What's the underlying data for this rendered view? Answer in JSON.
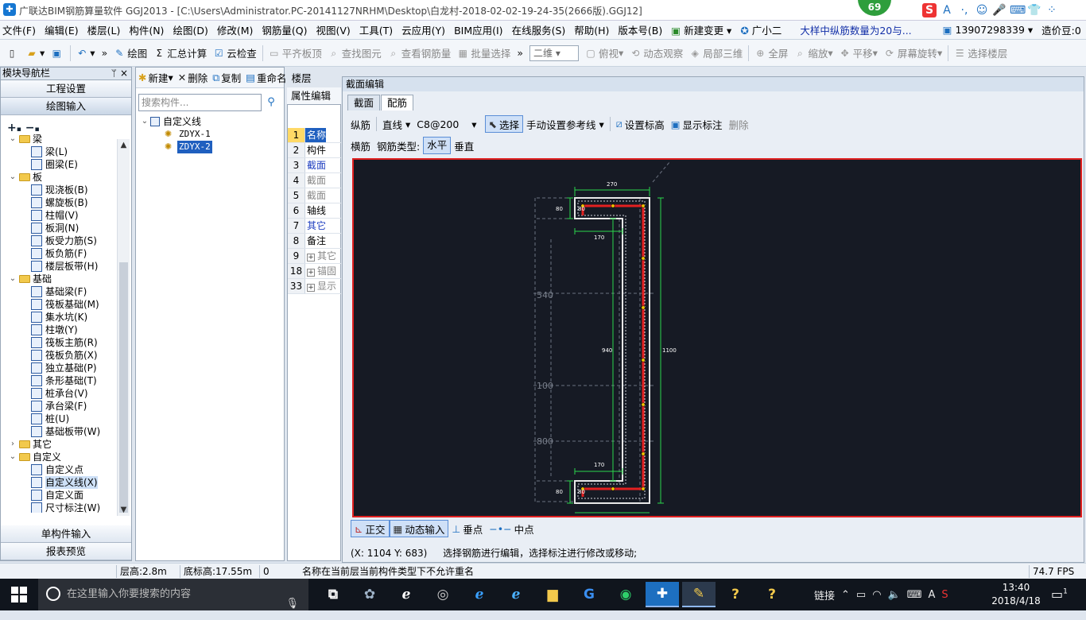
{
  "titlebar": {
    "title": "广联达BIM钢筋算量软件 GGJ2013 - [C:\\Users\\Administrator.PC-20141127NRHM\\Desktop\\白龙村-2018-02-02-19-24-35(2666版).GGJ12]",
    "badge": "69",
    "ime_icons": [
      "S",
      "A",
      "·,",
      "☺",
      "🎤",
      "⌨",
      "👕",
      "⁘"
    ]
  },
  "menubar": {
    "items": [
      "文件(F)",
      "编辑(E)",
      "楼层(L)",
      "构件(N)",
      "绘图(D)",
      "修改(M)",
      "钢筋量(Q)",
      "视图(V)",
      "工具(T)",
      "云应用(Y)",
      "BIM应用(I)",
      "在线服务(S)",
      "帮助(H)",
      "版本号(B)"
    ],
    "new_change": "新建变更",
    "assistant": "广小二",
    "notice": "大样中纵筋数量为20与...",
    "phone": "13907298339",
    "beans": "造价豆:0"
  },
  "toolbar": {
    "draw": "绘图",
    "sum": "汇总计算",
    "cloud_check": "云检查",
    "flat_top": "平齐板顶",
    "find_elem": "查找图元",
    "view_rebar": "查看钢筋量",
    "batch_select": "批量选择",
    "view_mode": "二维",
    "top_view": "俯视",
    "dyn_observe": "动态观察",
    "local_3d": "局部三维",
    "fullscreen": "全屏",
    "zoom": "缩放",
    "pan": "平移",
    "rotate": "屏幕旋转",
    "select_floor": "选择楼层"
  },
  "nav": {
    "title": "模块导航栏",
    "pin": "ᛘ",
    "close": "×",
    "top_buttons": [
      "工程设置",
      "绘图输入"
    ],
    "tree": [
      {
        "type": "folder",
        "label": "梁",
        "expanded": true
      },
      {
        "type": "leaf",
        "label": "梁(L)"
      },
      {
        "type": "leaf",
        "label": "圈梁(E)"
      },
      {
        "type": "folder",
        "label": "板",
        "expanded": true
      },
      {
        "type": "leaf",
        "label": "现浇板(B)"
      },
      {
        "type": "leaf",
        "label": "螺旋板(B)"
      },
      {
        "type": "leaf",
        "label": "柱帽(V)"
      },
      {
        "type": "leaf",
        "label": "板洞(N)"
      },
      {
        "type": "leaf",
        "label": "板受力筋(S)"
      },
      {
        "type": "leaf",
        "label": "板负筋(F)"
      },
      {
        "type": "leaf",
        "label": "楼层板带(H)"
      },
      {
        "type": "folder",
        "label": "基础",
        "expanded": true
      },
      {
        "type": "leaf",
        "label": "基础梁(F)"
      },
      {
        "type": "leaf",
        "label": "筏板基础(M)"
      },
      {
        "type": "leaf",
        "label": "集水坑(K)"
      },
      {
        "type": "leaf",
        "label": "柱墩(Y)"
      },
      {
        "type": "leaf",
        "label": "筏板主筋(R)"
      },
      {
        "type": "leaf",
        "label": "筏板负筋(X)"
      },
      {
        "type": "leaf",
        "label": "独立基础(P)"
      },
      {
        "type": "leaf",
        "label": "条形基础(T)"
      },
      {
        "type": "leaf",
        "label": "桩承台(V)"
      },
      {
        "type": "leaf",
        "label": "承台梁(F)"
      },
      {
        "type": "leaf",
        "label": "桩(U)"
      },
      {
        "type": "leaf",
        "label": "基础板带(W)"
      },
      {
        "type": "folder",
        "label": "其它",
        "expanded": false
      },
      {
        "type": "folder",
        "label": "自定义",
        "expanded": true
      },
      {
        "type": "leaf",
        "label": "自定义点"
      },
      {
        "type": "leaf",
        "label": "自定义线(X)",
        "selected": true
      },
      {
        "type": "leaf",
        "label": "自定义面"
      },
      {
        "type": "leaf",
        "label": "尺寸标注(W)"
      }
    ],
    "bottom_buttons": [
      "单构件输入",
      "报表预览"
    ]
  },
  "component": {
    "new": "新建",
    "delete": "删除",
    "copy": "复制",
    "rename": "重命名",
    "floor": "楼层",
    "search_placeholder": "搜索构件...",
    "root": "自定义线",
    "items": [
      "ZDYX-1",
      "ZDYX-2"
    ]
  },
  "properties": {
    "tab": "属性编辑",
    "rows": [
      {
        "n": "1",
        "label": "名称",
        "style": "sel"
      },
      {
        "n": "2",
        "label": "构件",
        "style": ""
      },
      {
        "n": "3",
        "label": "截面",
        "style": "blue"
      },
      {
        "n": "4",
        "label": "截面",
        "style": "gray"
      },
      {
        "n": "5",
        "label": "截面",
        "style": "gray"
      },
      {
        "n": "6",
        "label": "轴线",
        "style": ""
      },
      {
        "n": "7",
        "label": "其它",
        "style": "blue"
      },
      {
        "n": "8",
        "label": "备注",
        "style": ""
      },
      {
        "n": "9",
        "label": "其它",
        "style": "gray",
        "plus": true
      },
      {
        "n": "18",
        "label": "锚固",
        "style": "gray",
        "plus": true
      },
      {
        "n": "33",
        "label": "显示",
        "style": "gray",
        "plus": true
      }
    ]
  },
  "section_editor": {
    "title": "截面编辑",
    "tabs": [
      "截面",
      "配筋"
    ],
    "active_tab": 1,
    "longitudinal": "纵筋",
    "line_mode": "直线",
    "spec": "C8@200",
    "select": "选择",
    "ref_line": "手动设置参考线",
    "set_elevation": "设置标高",
    "show_annot": "显示标注",
    "delete": "删除",
    "transverse": "横筋",
    "rebar_type_label": "钢筋类型:",
    "horizontal": "水平",
    "vertical": "垂直",
    "ortho": "正交",
    "dyn_input": "动态输入",
    "perp_point": "垂点",
    "mid_point": "中点",
    "coords": "(X: 1104 Y: 683)",
    "hint": "选择钢筋进行编辑，选择标注进行修改或移动;"
  },
  "drawing": {
    "dims": {
      "top": "270",
      "top_left_h": "80",
      "top_inner_h": "80",
      "upper_inner": "170",
      "lower_inner": "170",
      "web_inner": "940",
      "overall": "1100",
      "bottom_h": "80",
      "bottom_inner_h": "80"
    },
    "bg_labels": [
      "540",
      "100",
      "800"
    ],
    "colors": {
      "bg": "#161a24",
      "outline": "#e8e8e8",
      "rebar": "#e32020",
      "dim": "#2bd64b",
      "node": "#f2c200"
    }
  },
  "statusbar": {
    "floor_height": "层高:2.8m",
    "base_elev": "底标高:17.55m",
    "count": "0",
    "message": "名称在当前层当前构件类型下不允许重名",
    "fps": "74.7 FPS"
  },
  "taskbar": {
    "search_placeholder": "在这里输入你要搜索的内容",
    "tray_link": "链接",
    "tray_lang": "A",
    "time": "13:40",
    "date": "2018/4/18",
    "notif_count": "1"
  }
}
